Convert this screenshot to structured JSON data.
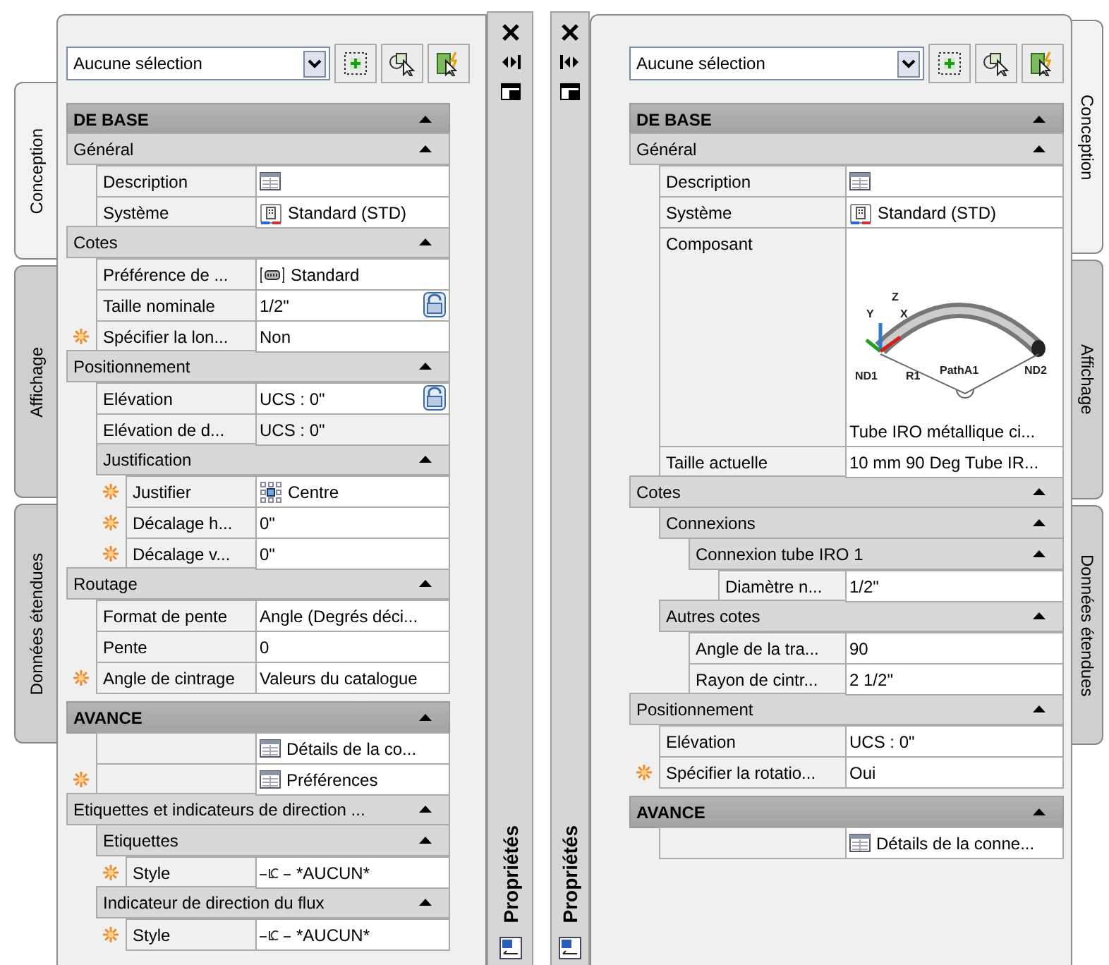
{
  "panels": [
    {
      "selection": "Aucune sélection",
      "palette_title": "Propriétés",
      "tabs": [
        {
          "label": "Conception",
          "selected": true
        },
        {
          "label": "Affichage",
          "selected": false
        },
        {
          "label": "Données étendues",
          "selected": false
        }
      ],
      "categories": [
        {
          "title": "DE BASE",
          "expanded": true,
          "children": [
            {
              "kind": "group",
              "title": "Général",
              "expanded": true,
              "children": [
                {
                  "kind": "table",
                  "label": "Description"
                },
                {
                  "kind": "system",
                  "label": "Système",
                  "value": "Standard (STD)"
                }
              ]
            },
            {
              "kind": "group",
              "title": "Cotes",
              "expanded": true,
              "children": [
                {
                  "kind": "fitting",
                  "label": "Préférence de ...",
                  "value": "Standard"
                },
                {
                  "kind": "property",
                  "label": "Taille nominale",
                  "value": "1/2\"",
                  "lock": true
                },
                {
                  "kind": "property",
                  "label": "Spécifier la lon...",
                  "value": "Non",
                  "starred": true
                }
              ]
            },
            {
              "kind": "group",
              "title": "Positionnement",
              "expanded": true,
              "children": [
                {
                  "kind": "property",
                  "label": "Elévation",
                  "value": "UCS : 0\"",
                  "lock": true
                },
                {
                  "kind": "property",
                  "label": "Elévation de d...",
                  "value": "UCS : 0\"",
                  "readonly": true
                },
                {
                  "kind": "group",
                  "title": "Justification",
                  "expanded": true,
                  "children": [
                    {
                      "kind": "justification",
                      "label": "Justifier",
                      "value": "Centre",
                      "starred": true
                    },
                    {
                      "kind": "property",
                      "label": "Décalage h...",
                      "value": "0\"",
                      "starred": true
                    },
                    {
                      "kind": "property",
                      "label": "Décalage v...",
                      "value": "0\"",
                      "starred": true
                    }
                  ]
                }
              ]
            },
            {
              "kind": "group",
              "title": "Routage",
              "expanded": true,
              "children": [
                {
                  "kind": "property",
                  "label": "Format de pente",
                  "value": "Angle (Degrés déci..."
                },
                {
                  "kind": "property",
                  "label": "Pente",
                  "value": "0"
                },
                {
                  "kind": "property",
                  "label": "Angle de cintrage",
                  "value": "Valeurs du catalogue",
                  "starred": true
                }
              ]
            }
          ]
        },
        {
          "title": "AVANCE",
          "expanded": true,
          "children": [
            {
              "kind": "table",
              "value": "Détails de la co..."
            },
            {
              "kind": "table",
              "value": "Préférences",
              "starred": true
            },
            {
              "kind": "group",
              "title": "Etiquettes et indicateurs de direction ...",
              "expanded": true,
              "children": [
                {
                  "kind": "group",
                  "title": "Etiquettes",
                  "expanded": true,
                  "children": [
                    {
                      "kind": "label",
                      "label": "Style",
                      "value": "*AUCUN*",
                      "starred": true
                    }
                  ]
                },
                {
                  "kind": "group",
                  "title": "Indicateur de direction du flux",
                  "expanded": true,
                  "children": [
                    {
                      "kind": "label",
                      "label": "Style",
                      "value": "*AUCUN*",
                      "starred": true
                    }
                  ]
                }
              ]
            }
          ]
        }
      ]
    },
    {
      "selection": "Aucune sélection",
      "palette_title": "Propriétés",
      "tabs": [
        {
          "label": "Conception",
          "selected": true
        },
        {
          "label": "Affichage",
          "selected": false
        },
        {
          "label": "Données étendues",
          "selected": false
        }
      ],
      "categories": [
        {
          "title": "DE BASE",
          "expanded": true,
          "children": [
            {
              "kind": "group",
              "title": "Général",
              "expanded": true,
              "children": [
                {
                  "kind": "table",
                  "label": "Description"
                },
                {
                  "kind": "system",
                  "label": "Système",
                  "value": "Standard (STD)"
                },
                {
                  "kind": "preview",
                  "label": "Composant",
                  "caption": "Tube IRO métallique ci...",
                  "diagram_labels": [
                    "ND1",
                    "R1",
                    "PathA1",
                    "ND2",
                    "Z",
                    "Y",
                    "X"
                  ]
                },
                {
                  "kind": "property",
                  "label": "Taille actuelle",
                  "value": "10 mm 90 Deg Tube IR..."
                }
              ]
            },
            {
              "kind": "group",
              "title": "Cotes",
              "expanded": true,
              "children": [
                {
                  "kind": "group",
                  "title": "Connexions",
                  "expanded": true,
                  "children": [
                    {
                      "kind": "group",
                      "title": "Connexion tube IRO 1",
                      "expanded": true,
                      "children": [
                        {
                          "kind": "property",
                          "label": "Diamètre n...",
                          "value": "1/2\""
                        }
                      ]
                    }
                  ]
                },
                {
                  "kind": "group",
                  "title": "Autres cotes",
                  "expanded": true,
                  "children": [
                    {
                      "kind": "property",
                      "label": "Angle de la tra...",
                      "value": "90"
                    },
                    {
                      "kind": "property",
                      "label": "Rayon de cintr...",
                      "value": "2 1/2\""
                    }
                  ]
                }
              ]
            },
            {
              "kind": "group",
              "title": "Positionnement",
              "expanded": true,
              "children": [
                {
                  "kind": "property",
                  "label": "Elévation",
                  "value": "UCS : 0\""
                },
                {
                  "kind": "property",
                  "label": "Spécifier la rotatio...",
                  "value": "Oui",
                  "starred": true
                }
              ]
            }
          ]
        },
        {
          "title": "AVANCE",
          "expanded": true,
          "children": [
            {
              "kind": "table",
              "value": "Détails de la conne..."
            }
          ]
        }
      ]
    }
  ]
}
